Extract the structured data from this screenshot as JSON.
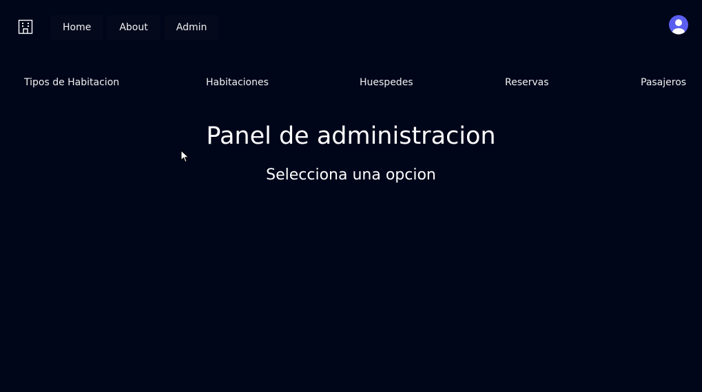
{
  "header": {
    "logo_icon": "building-icon",
    "nav": [
      {
        "label": "Home"
      },
      {
        "label": "About"
      },
      {
        "label": "Admin"
      }
    ],
    "avatar_icon": "user-avatar-icon",
    "avatar_color": "#5b5ff0"
  },
  "admin_nav": [
    {
      "label": "Tipos de Habitacion"
    },
    {
      "label": "Habitaciones"
    },
    {
      "label": "Huespedes"
    },
    {
      "label": "Reservas"
    },
    {
      "label": "Pasajeros"
    }
  ],
  "main": {
    "title": "Panel de administracion",
    "subtitle": "Selecciona una opcion"
  },
  "theme": {
    "background": "#00061a",
    "text": "#ffffff"
  }
}
